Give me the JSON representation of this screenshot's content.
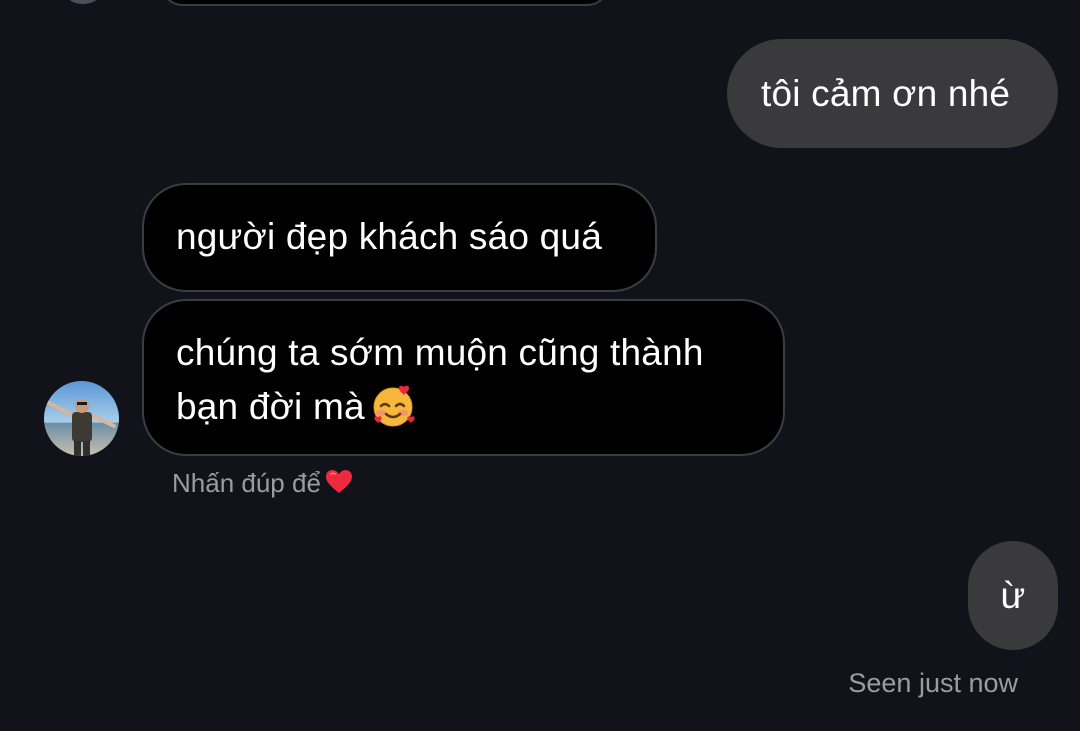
{
  "messages": {
    "sent_1": "tôi cảm ơn nhé",
    "received_1": "người đẹp khách sáo quá",
    "received_2_line1": "chúng ta sớm muộn cũng thành",
    "received_2_line2": "bạn đời mà",
    "sent_2": "ừ"
  },
  "hint": {
    "label": "Nhấn đúp để",
    "icon": "heart-icon"
  },
  "status": {
    "seen": "Seen just now"
  },
  "icons": {
    "emoji": "smiling-face-with-hearts-emoji",
    "heart_color": "#ee2a3f"
  },
  "colors": {
    "background": "#12131a",
    "sent_bubble": "#3a3a3c",
    "received_bubble": "#000000",
    "received_border": "#3c3c42",
    "meta_text": "#9b9ba3"
  }
}
